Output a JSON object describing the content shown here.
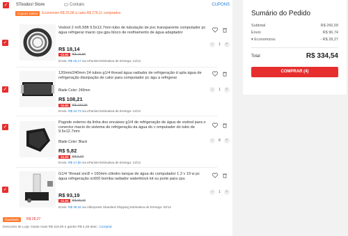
{
  "store": {
    "name": "SToodos! Store",
    "contact": "Contato",
    "cupons": "CUPONS"
  },
  "coupon": {
    "tag": "Cupons Select",
    "text": "Economize R$ 25,68 a cada R$ 278,11 comprados"
  },
  "items": [
    {
      "title": "Vodool 2 m/6.56ft 9.5x12.7mm tubo de tubulação de pvc transparente computador pc água refrigerar macio cpu gpu bloco de resfriamento de água adaptador",
      "specs": "",
      "price": "R$ 18,14",
      "discount": "-11.61",
      "old_price": "R$ 16,65",
      "ship_prefix": "Envio:",
      "ship_amount": "R$ 16,17",
      "ship_suffix": "via ePacket  Estimativa de Entrega: 13/12",
      "qty": "1"
    },
    {
      "title": "120mm/240mm 24 tubos g1/4 thread água radiador de refrigeração d upla água de refrigeração dissipação de calor para computador pc águ a refrigerar",
      "specs": "Blade Color: 240mm",
      "price": "R$ 108,21",
      "discount": "-11.61",
      "old_price": "R$ 100,56",
      "ship_prefix": "Envio:",
      "ship_amount": "R$ 24,73",
      "ship_suffix": "via ePacket  Estimativa de Entrega: 13/12",
      "qty": "1"
    },
    {
      "title": "Pagode externo da linha dos encaixes g1/4 de refrigeração de água de vodool para o conector macio do sistema de refrigeração da água do c omputador do tubo de 9.5x12.7mm",
      "specs": "Blade Color: Black",
      "price": "R$ 5,82",
      "discount": "-11.61",
      "old_price": "R$ 5,07",
      "ship_prefix": "Envio:",
      "ship_amount": "R$ 17,50",
      "ship_suffix": "via ePacket  Estimativa de Entrega: 13/12",
      "qty": "8"
    },
    {
      "title": "G1/4 \"thread xnc8 + 160mm cilindro tanque de água do computador 1 2 v 19 w pc água refrigeração sc600 bomba radiador waterblock kit su porte para cpu",
      "specs": "",
      "price": "R$ 93,19",
      "discount": "-11.61",
      "old_price": "R$ 90,70",
      "ship_prefix": "Envio:",
      "ship_amount": "R$ 38,34",
      "ship_suffix": "via AliExpress Standard Shipping  Estimativa de Entrega: 02/12",
      "qty": "1"
    }
  ],
  "footer": {
    "saved_tag": "Guardado",
    "saved_amount": "R$ 28,27",
    "store_discount_label": "Desconto de Loja:",
    "store_discount_text": "Gaste mais R$ 118,90 e ganhe R$ 4,28 desc.",
    "buy_link": "Comprar"
  },
  "summary": {
    "title": "Sumário do Pedido",
    "subtotal_label": "Subtotal",
    "subtotal": "R$ 266,09",
    "shipping_label": "Envio",
    "shipping": "R$ 96,74",
    "savings_label": "Economizou",
    "savings": "- R$ 28,27",
    "total_label": "Total",
    "total": "R$ 334,54",
    "buy_button": "COMPRAR (4)"
  },
  "colors": {
    "accent": "#e62e2e",
    "link": "#1a7bd6",
    "coupon": "#ff7a2f"
  }
}
